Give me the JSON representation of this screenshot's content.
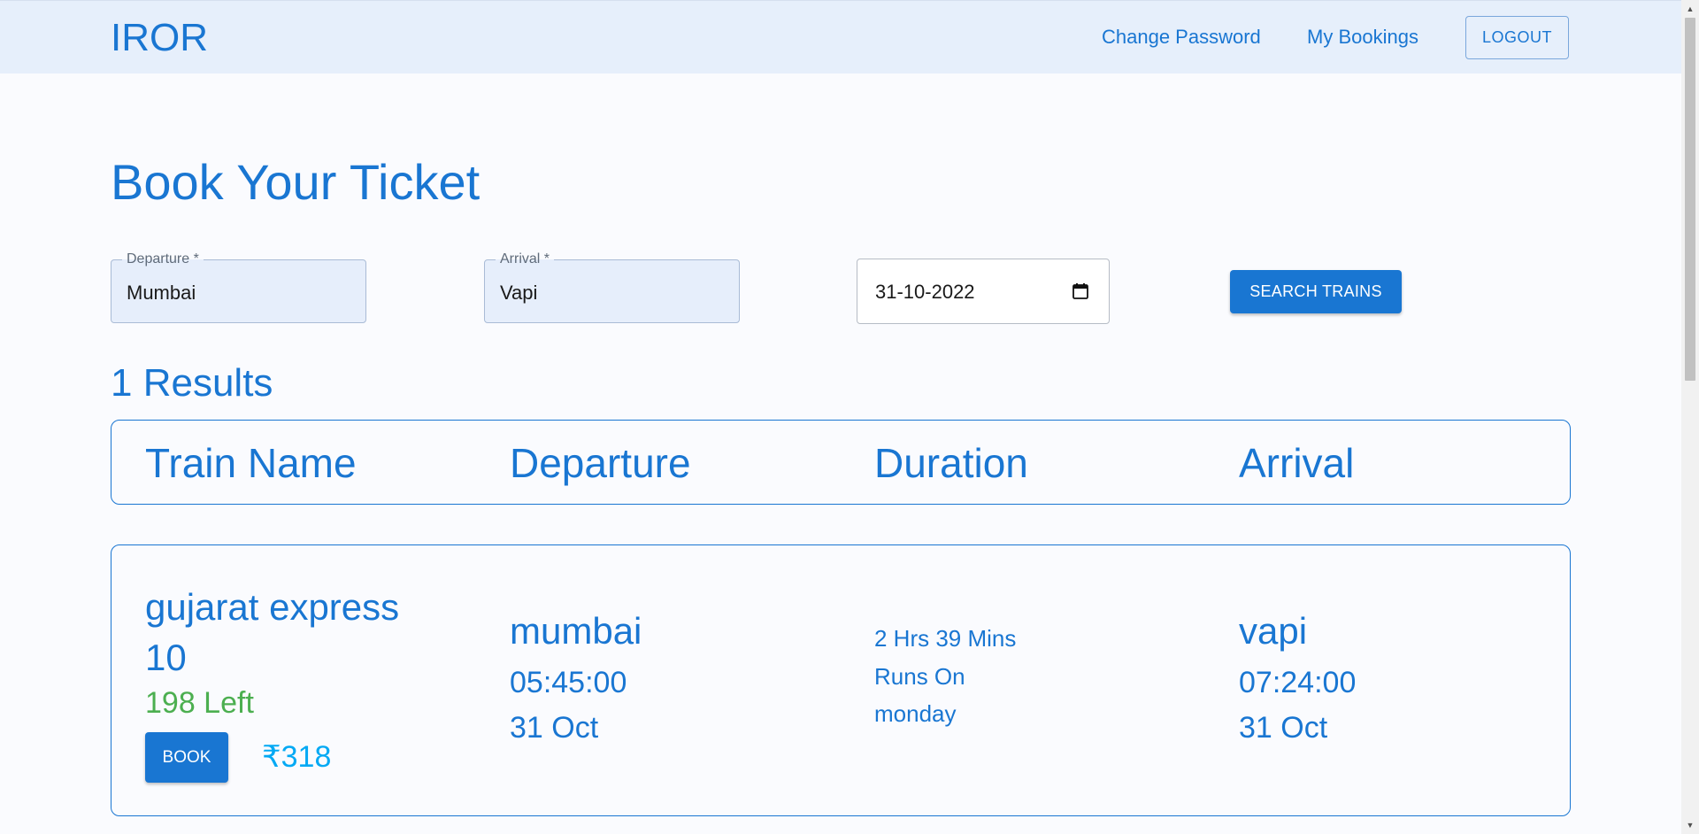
{
  "nav": {
    "logo": "IROR",
    "links": [
      "Change Password",
      "My Bookings"
    ],
    "logout_label": "LOGOUT"
  },
  "page": {
    "title": "Book Your Ticket"
  },
  "search": {
    "departure_label": "Departure *",
    "departure_value": "Mumbai",
    "arrival_label": "Arrival *",
    "arrival_value": "Vapi",
    "date_value": "31-10-2022",
    "button_label": "SEARCH TRAINS"
  },
  "results": {
    "count_text": "1 Results",
    "columns": [
      "Train Name",
      "Departure",
      "Duration",
      "Arrival"
    ],
    "items": [
      {
        "train_name": "gujarat express 10",
        "seats_left": "198 Left",
        "book_label": "BOOK",
        "price": "₹318",
        "departure_station": "mumbai",
        "departure_time": "05:45:00",
        "departure_date": "31 Oct",
        "duration": "2 Hrs 39 Mins",
        "runs_on_label": "Runs On",
        "runs_on_day": "monday",
        "arrival_station": "vapi",
        "arrival_time": "07:24:00",
        "arrival_date": "31 Oct"
      }
    ]
  },
  "icons": {
    "date_picker": "calendar-icon",
    "scroll_up": "scroll-up-arrow-icon",
    "scroll_down": "scroll-down-arrow-icon"
  },
  "colors": {
    "primary": "#1976d2",
    "navbar_bg": "#e6effb",
    "seats_green": "#4caf50",
    "price_blue": "#03a9f4"
  }
}
